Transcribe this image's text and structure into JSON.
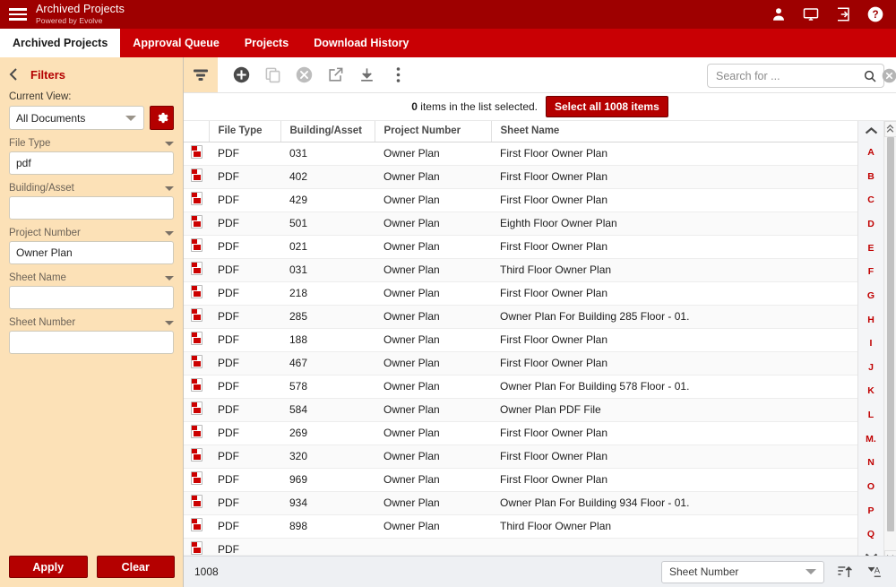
{
  "header": {
    "title": "Archived Projects",
    "subtitle": "Powered by Evolve",
    "icons": [
      "user-icon",
      "monitor-icon",
      "logout-icon",
      "help-icon"
    ]
  },
  "tabs": [
    {
      "label": "Archived Projects",
      "active": true
    },
    {
      "label": "Approval Queue",
      "active": false
    },
    {
      "label": "Projects",
      "active": false
    },
    {
      "label": "Download History",
      "active": false
    }
  ],
  "sidebar": {
    "heading": "Filters",
    "current_view_label": "Current View:",
    "current_view_value": "All Documents",
    "fields": [
      {
        "label": "File Type",
        "value": "pdf"
      },
      {
        "label": "Building/Asset",
        "value": ""
      },
      {
        "label": "Project Number",
        "value": "Owner Plan"
      },
      {
        "label": "Sheet Name",
        "value": ""
      },
      {
        "label": "Sheet Number",
        "value": ""
      }
    ],
    "apply_label": "Apply",
    "clear_label": "Clear"
  },
  "toolbar": {
    "icons": [
      "filter-icon",
      "add-icon",
      "copy-icon",
      "delete-icon",
      "open-external-icon",
      "download-icon",
      "more-options-icon"
    ],
    "search_placeholder": "Search for ...",
    "search_value": ""
  },
  "selection": {
    "count": "0",
    "message": " items in the list selected.",
    "select_all_label": "Select all 1008 items"
  },
  "table": {
    "columns": [
      "File Type",
      "Building/Asset",
      "Project Number",
      "Sheet Name"
    ],
    "rows": [
      {
        "file_type": "PDF",
        "building": "031",
        "project": "Owner Plan",
        "sheet": "First Floor Owner Plan"
      },
      {
        "file_type": "PDF",
        "building": "402",
        "project": "Owner Plan",
        "sheet": "First Floor Owner Plan"
      },
      {
        "file_type": "PDF",
        "building": "429",
        "project": "Owner Plan",
        "sheet": "First Floor Owner Plan"
      },
      {
        "file_type": "PDF",
        "building": "501",
        "project": "Owner Plan",
        "sheet": "Eighth Floor Owner Plan"
      },
      {
        "file_type": "PDF",
        "building": "021",
        "project": "Owner Plan",
        "sheet": "First Floor Owner Plan"
      },
      {
        "file_type": "PDF",
        "building": "031",
        "project": "Owner Plan",
        "sheet": "Third Floor Owner Plan"
      },
      {
        "file_type": "PDF",
        "building": "218",
        "project": "Owner Plan",
        "sheet": "First Floor Owner Plan"
      },
      {
        "file_type": "PDF",
        "building": "285",
        "project": "Owner Plan",
        "sheet": "Owner Plan For Building 285 Floor - 01."
      },
      {
        "file_type": "PDF",
        "building": "188",
        "project": "Owner Plan",
        "sheet": "First Floor Owner Plan"
      },
      {
        "file_type": "PDF",
        "building": "467",
        "project": "Owner Plan",
        "sheet": "First Floor Owner Plan"
      },
      {
        "file_type": "PDF",
        "building": "578",
        "project": "Owner Plan",
        "sheet": "Owner Plan For Building 578 Floor - 01."
      },
      {
        "file_type": "PDF",
        "building": "584",
        "project": "Owner Plan",
        "sheet": "Owner Plan PDF File"
      },
      {
        "file_type": "PDF",
        "building": "269",
        "project": "Owner Plan",
        "sheet": "First Floor Owner Plan"
      },
      {
        "file_type": "PDF",
        "building": "320",
        "project": "Owner Plan",
        "sheet": "First Floor Owner Plan"
      },
      {
        "file_type": "PDF",
        "building": "969",
        "project": "Owner Plan",
        "sheet": "First Floor Owner Plan"
      },
      {
        "file_type": "PDF",
        "building": "934",
        "project": "Owner Plan",
        "sheet": "Owner Plan For Building 934 Floor - 01."
      },
      {
        "file_type": "PDF",
        "building": "898",
        "project": "Owner Plan",
        "sheet": "Third Floor Owner Plan"
      },
      {
        "file_type": "PDF",
        "building": "",
        "project": "",
        "sheet": ""
      }
    ]
  },
  "alpha_index": [
    "A",
    "B",
    "C",
    "D",
    "E",
    "F",
    "G",
    "H",
    "I",
    "J",
    "K",
    "L",
    "M.",
    "N",
    "O",
    "P",
    "Q"
  ],
  "status": {
    "count": "1008",
    "sort_field": "Sheet Number",
    "sort_icons": [
      "sort-ascending-icon",
      "sort-alpha-icon"
    ]
  },
  "colors": {
    "topbar_red": "#9e0000",
    "nav_red": "#c90004",
    "button_red": "#b40000",
    "sidebar_peach": "#fce1b7",
    "alpha_red": "#c00000"
  }
}
